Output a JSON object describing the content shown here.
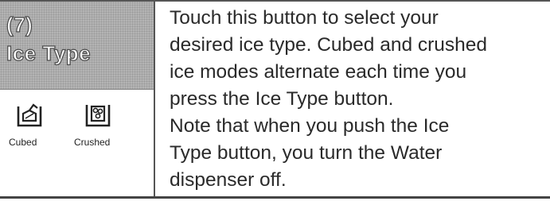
{
  "header": {
    "number": "(7)",
    "title": "Ice Type"
  },
  "icons": {
    "cubed": {
      "icon": "cubed-ice-icon",
      "caption": "Cubed"
    },
    "crushed": {
      "icon": "crushed-ice-icon",
      "caption": "Crushed"
    }
  },
  "description": {
    "lines": [
      "Touch this button to select your",
      "desired ice type. Cubed and crushed",
      "ice modes alternate each time you",
      "press the Ice Type button.",
      "Note that when you push the Ice",
      "Type button, you turn the Water",
      "dispenser off."
    ]
  }
}
